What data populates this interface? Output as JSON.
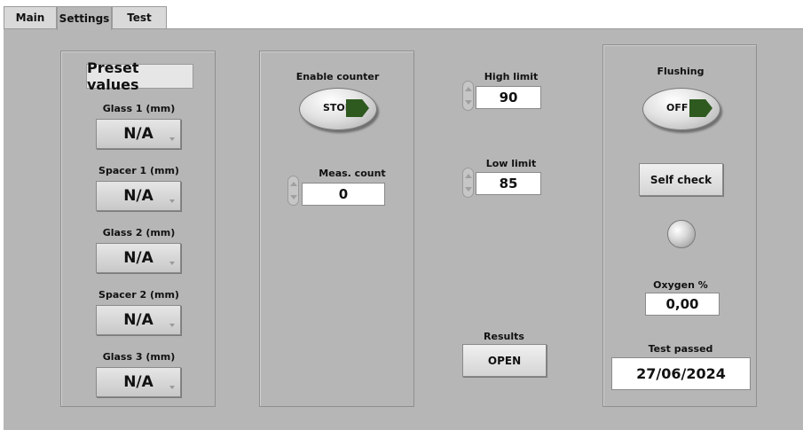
{
  "tabs": [
    {
      "label": "Main",
      "active": false
    },
    {
      "label": "Settings",
      "active": true
    },
    {
      "label": "Test",
      "active": false
    }
  ],
  "preset": {
    "title": "Preset values",
    "items": [
      {
        "label": "Glass 1 (mm)",
        "value": "N/A"
      },
      {
        "label": "Spacer 1 (mm)",
        "value": "N/A"
      },
      {
        "label": "Glass 2 (mm)",
        "value": "N/A"
      },
      {
        "label": "Spacer 2 (mm)",
        "value": "N/A"
      },
      {
        "label": "Glass 3 (mm)",
        "value": "N/A"
      }
    ]
  },
  "counter": {
    "enable_label": "Enable counter",
    "toggle_text": "STOP",
    "meas_label": "Meas. count",
    "meas_value": "0"
  },
  "limits": {
    "high_label": "High limit",
    "high_value": "90",
    "low_label": "Low limit",
    "low_value": "85"
  },
  "results": {
    "label": "Results",
    "button": "OPEN"
  },
  "flushing": {
    "label": "Flushing",
    "toggle_text": "OFF",
    "self_check": "Self check",
    "oxygen_label": "Oxygen %",
    "oxygen_value": "0,00",
    "test_label": "Test passed",
    "test_value": "27/06/2024"
  },
  "colors": {
    "panel_bg": "#b6b6b6",
    "toggle_led": "#2e5a1f"
  }
}
